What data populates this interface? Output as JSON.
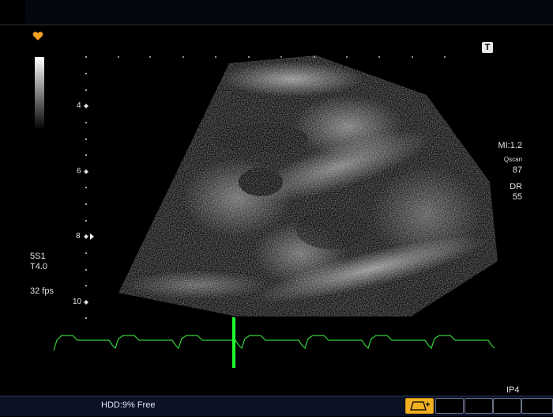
{
  "header": {
    "title_bar": ""
  },
  "probe": {
    "name": "5S1",
    "setting": "T4.0",
    "frame_rate": "32 fps"
  },
  "params": {
    "mi": "MI:1.2",
    "qscan_label": "Qscan",
    "qscan_value": "87",
    "dr_label": "DR",
    "dr_value": "55"
  },
  "depth_scale": {
    "labels": [
      "4",
      "6",
      "8",
      "10"
    ]
  },
  "badge": {
    "t": "T"
  },
  "footer": {
    "hdd": "HDD:9% Free",
    "preset": "IP4"
  },
  "colors": {
    "ecg": "#35d03a",
    "ecg_marker": "#20ff30",
    "heart_icon": "#f0a020",
    "active_key": "#f0b020"
  },
  "icons": [
    "heart-icon",
    "t-badge-icon",
    "capture-icon"
  ]
}
